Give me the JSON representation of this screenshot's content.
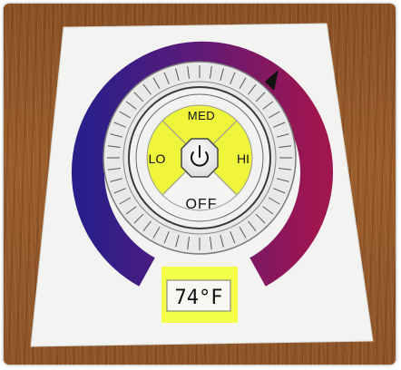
{
  "thermostat": {
    "modes": {
      "med": "MED",
      "lo": "LO",
      "hi": "HI",
      "off": "OFF"
    },
    "power_icon": "power-icon",
    "temperature": "74°F"
  },
  "colors": {
    "background_wood": "#8a5126",
    "card": "#f4f4f4",
    "ring_purple": "#4a1a8c",
    "ring_magenta": "#a0165e",
    "active_mode": "#eef53a",
    "readout_highlight": "#f4ff4a"
  }
}
